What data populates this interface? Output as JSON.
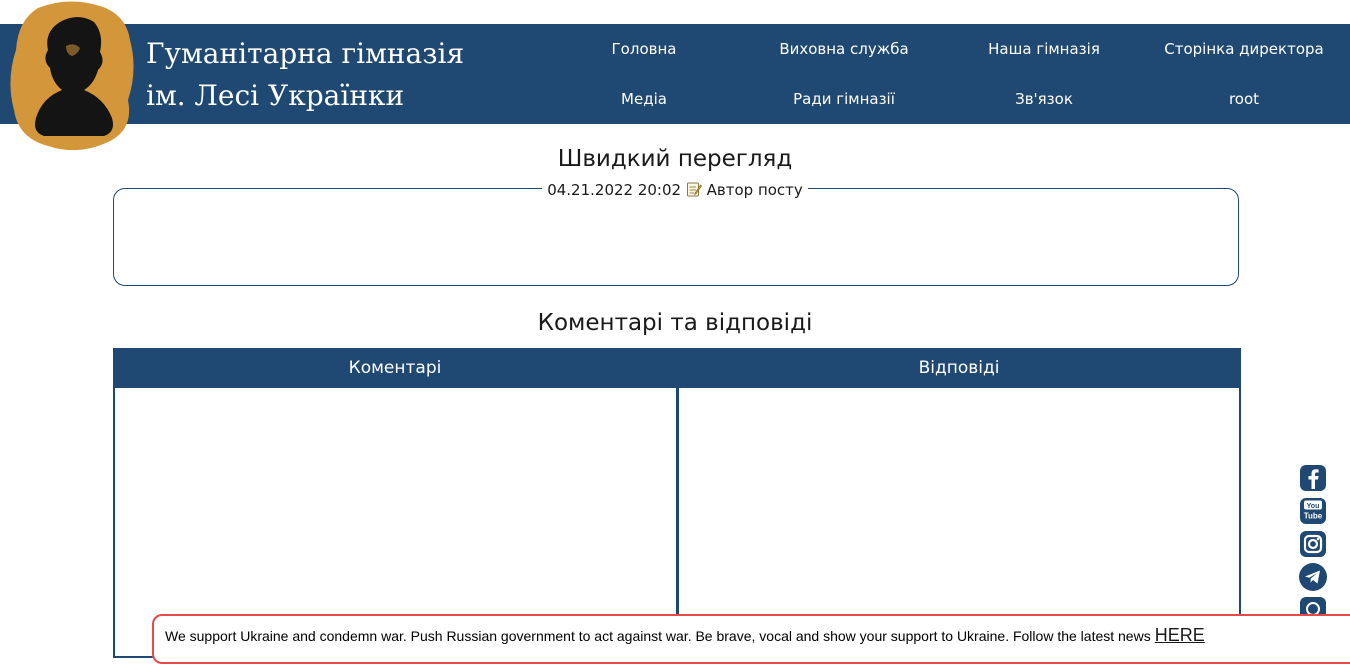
{
  "site": {
    "title_line1": "Гуманітарна гімназія",
    "title_line2": "ім. Лесі Українки"
  },
  "nav": {
    "items": [
      "Головна",
      "Виховна служба",
      "Наша гімназія",
      "Сторінка директора",
      "Медіа",
      "Ради гімназії",
      "Зв'язок",
      "root"
    ]
  },
  "post": {
    "heading": "Швидкий перегляд",
    "date": "04.21.2022 20:02",
    "author": "Автор посту"
  },
  "comments": {
    "heading": "Коментарі та відповіді",
    "col_comments": "Коментарі",
    "col_replies": "Відповіді"
  },
  "socials": [
    "facebook-icon",
    "youtube-icon",
    "instagram-icon",
    "telegram-icon",
    "viber-icon"
  ],
  "banner": {
    "text": "We support Ukraine and condemn war. Push Russian government to act against war. Be brave, vocal and show your support to Ukraine. Follow the latest news",
    "link": "HERE"
  },
  "colors": {
    "primary": "#1f4872",
    "logo_gold": "#d4963a",
    "banner_border": "#e84a4a"
  }
}
